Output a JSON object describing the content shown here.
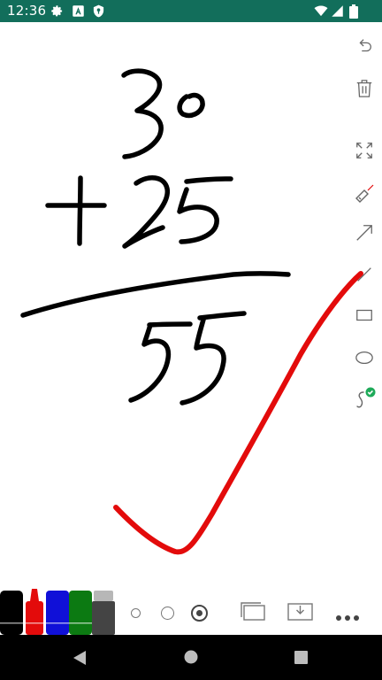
{
  "status_bar": {
    "time": "12:36",
    "left_icons": [
      "settings-icon",
      "font-icon",
      "shield-icon"
    ],
    "right_icons": [
      "wifi-icon",
      "signal-icon",
      "battery-icon"
    ]
  },
  "canvas": {
    "ink_colors": {
      "black": "#000000",
      "red": "#e30b0b"
    }
  },
  "toolbar": {
    "tools": [
      "undo-icon",
      "trash-icon",
      "fullscreen-icon",
      "laser-pointer-icon",
      "arrow-icon",
      "line-icon",
      "rectangle-icon",
      "ellipse-icon",
      "freehand-icon"
    ],
    "active_tool": "freehand"
  },
  "palette": {
    "markers": [
      {
        "name": "black",
        "color": "#000000"
      },
      {
        "name": "red",
        "color": "#e30b0b"
      },
      {
        "name": "blue",
        "color": "#1010d8"
      },
      {
        "name": "green",
        "color": "#0c7a12"
      },
      {
        "name": "gray",
        "color": "#444444"
      }
    ],
    "selected_marker": "red",
    "pen_sizes": [
      "small",
      "medium",
      "large"
    ],
    "selected_size": "large"
  },
  "bottom_actions": [
    "pages-icon",
    "download-icon",
    "more-icon"
  ],
  "nav_bar": [
    "back-icon",
    "home-icon",
    "recents-icon"
  ]
}
